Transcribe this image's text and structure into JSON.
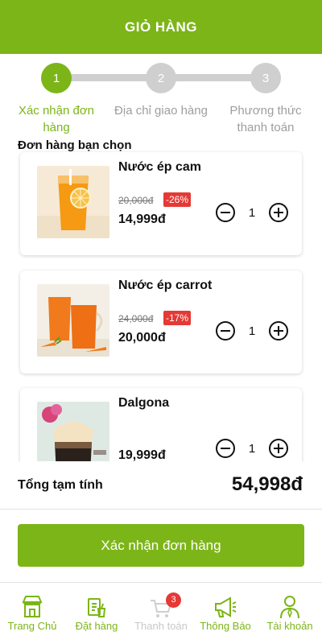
{
  "header": {
    "title": "GIỎ HÀNG"
  },
  "stepper": {
    "steps": [
      {
        "number": "1",
        "label": "Xác nhận đơn hàng"
      },
      {
        "number": "2",
        "label": "Địa chỉ giao hàng"
      },
      {
        "number": "3",
        "label": "Phương thức thanh toán"
      }
    ],
    "active_step": 1
  },
  "section_title": "Đơn hàng bạn chọn",
  "items": [
    {
      "name": "Nước ép cam",
      "old_price": "20,000đ",
      "discount": "-26%",
      "price": "14,999đ",
      "quantity": "1",
      "image_icon": "orange-juice-photo"
    },
    {
      "name": "Nước ép carrot",
      "old_price": "24,000đ",
      "discount": "-17%",
      "price": "20,000đ",
      "quantity": "1",
      "image_icon": "carrot-juice-photo"
    },
    {
      "name": "Dalgona",
      "price": "19,999đ",
      "quantity": "1",
      "image_icon": "dalgona-coffee-photo"
    }
  ],
  "total": {
    "label": "Tổng tạm tính",
    "value": "54,998đ"
  },
  "confirm_button": "Xác nhận đơn hàng",
  "tabs": [
    {
      "label": "Trang Chủ",
      "icon": "store-icon"
    },
    {
      "label": "Đặt hàng",
      "icon": "order-icon"
    },
    {
      "label": "Thanh toán",
      "icon": "cart-icon",
      "badge": "3",
      "disabled": true
    },
    {
      "label": "Thông Báo",
      "icon": "megaphone-icon"
    },
    {
      "label": "Tài khoản",
      "icon": "user-icon"
    }
  ],
  "colors": {
    "brand": "#7cb518",
    "inactive": "#cfcfcf",
    "discount": "#e53935"
  }
}
